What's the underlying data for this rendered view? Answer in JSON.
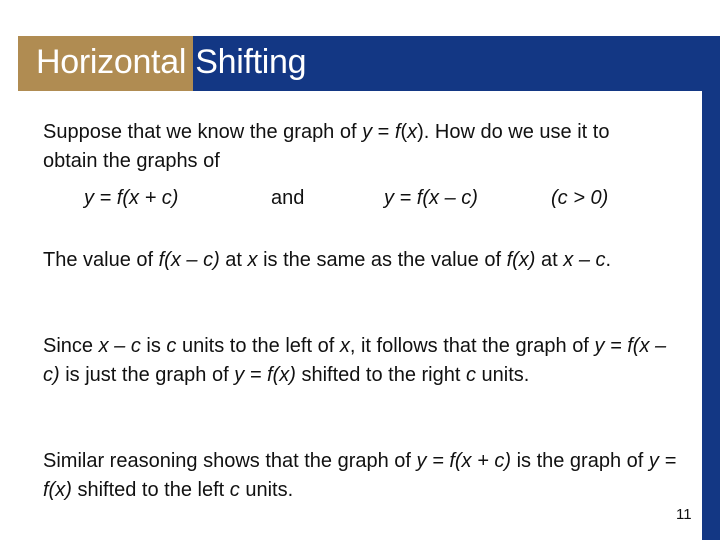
{
  "slide": {
    "title": "Horizontal Shifting",
    "page_number": "11",
    "colors": {
      "title_gold": "#b08c52",
      "title_blue": "#133784",
      "title_text": "#ffffff",
      "body_text": "#111111"
    }
  },
  "intro": {
    "text1": "Suppose that we know the graph of ",
    "y": "y",
    "eq": " = ",
    "fx": "f",
    "x_open": "(",
    "x": "x",
    "close_text": "). How do we use it to obtain the graphs of"
  },
  "formulas": {
    "left": "y = f(x + c)",
    "and": "and",
    "right": "y = f(x – c)",
    "condition": "(c > 0)"
  },
  "paragraph2": {
    "part1": "The value of ",
    "fxc": "f(x – c)",
    "part2": " at ",
    "x": "x",
    "part3": " is the same as the value of ",
    "fx": "f(x)",
    "part4": " at ",
    "xc": "x – c",
    "part5": "."
  },
  "paragraph3": {
    "part1": "Since ",
    "xc": "x – c",
    "part2": " is ",
    "c": "c",
    "part3": " units to the left of ",
    "x": "x",
    "part4": ", it follows that the graph of ",
    "eq1": "y = f(x – c)",
    "part5": " is just the graph of ",
    "eq2": "y = f(x)",
    "part6": " shifted to the right ",
    "c2": "c",
    "part7": " units."
  },
  "paragraph4": {
    "part1": "Similar reasoning shows that the graph of ",
    "eq1": "y = f(x + c)",
    "part2": " is the graph of ",
    "eq2": "y = f(x)",
    "part3": " shifted to the left ",
    "c": "c",
    "part4": " units."
  }
}
